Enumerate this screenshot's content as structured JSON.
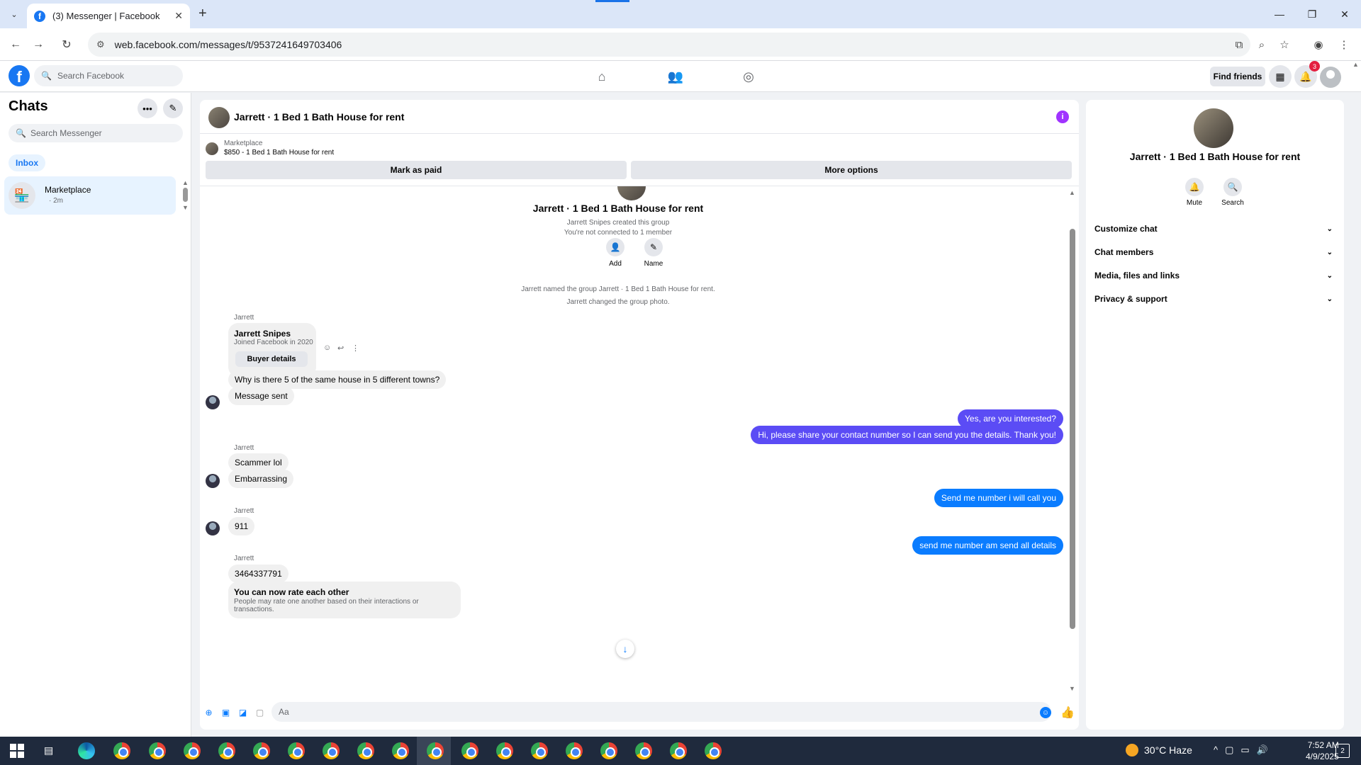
{
  "browser": {
    "tab_title": "(3) Messenger | Facebook",
    "url": "web.facebook.com/messages/t/9537241649703406"
  },
  "fb": {
    "search_placeholder": "Search Facebook",
    "find_friends": "Find friends",
    "notification_count": "3"
  },
  "chats": {
    "title": "Chats",
    "search_placeholder": "Search Messenger",
    "filter_inbox": "Inbox",
    "items": [
      {
        "name": "Marketplace",
        "time": "· 2m"
      }
    ]
  },
  "conversation": {
    "title": "Jarrett · 1 Bed 1 Bath House for rent",
    "marketplace_label": "Marketplace",
    "listing": "$850 - 1 Bed 1 Bath House for rent",
    "mark_as_paid": "Mark as paid",
    "more_options": "More options",
    "group_title": "Jarrett · 1 Bed 1 Bath House for rent",
    "created_text": "Jarrett Snipes created this group",
    "not_connected_text": "You're not connected to 1 member",
    "add_label": "Add",
    "name_label": "Name",
    "event_named": "Jarrett named the group Jarrett · 1 Bed 1 Bath House for rent.",
    "event_photo": "Jarrett changed the group photo.",
    "sender_name": "Jarrett",
    "card_name": "Jarrett Snipes",
    "card_joined": "Joined Facebook in 2020",
    "card_button": "Buyer details",
    "messages": {
      "m1": "Why is there 5 of the same house in 5 different towns?",
      "m2": "Message sent",
      "m3": "Yes, are you interested?",
      "m4": "Hi, please share your contact number so I can send you the details. Thank you!",
      "m5": "Scammer lol",
      "m6": "Embarrassing",
      "m7": "Send me number i will call you",
      "m8": "911",
      "m9": "send me number am send all details",
      "m10": "3464337791"
    },
    "rate_title": "You can now rate each other",
    "rate_sub": "People may rate one another based on their interactions or transactions.",
    "composer_placeholder": "Aa"
  },
  "info_panel": {
    "title": "Jarrett · 1 Bed 1 Bath House for rent",
    "mute": "Mute",
    "search": "Search",
    "sections": [
      "Customize chat",
      "Chat members",
      "Media, files and links",
      "Privacy & support"
    ]
  },
  "taskbar": {
    "weather": "30°C  Haze",
    "time": "7:52 AM",
    "date": "4/9/2025",
    "notif_count": "2"
  }
}
